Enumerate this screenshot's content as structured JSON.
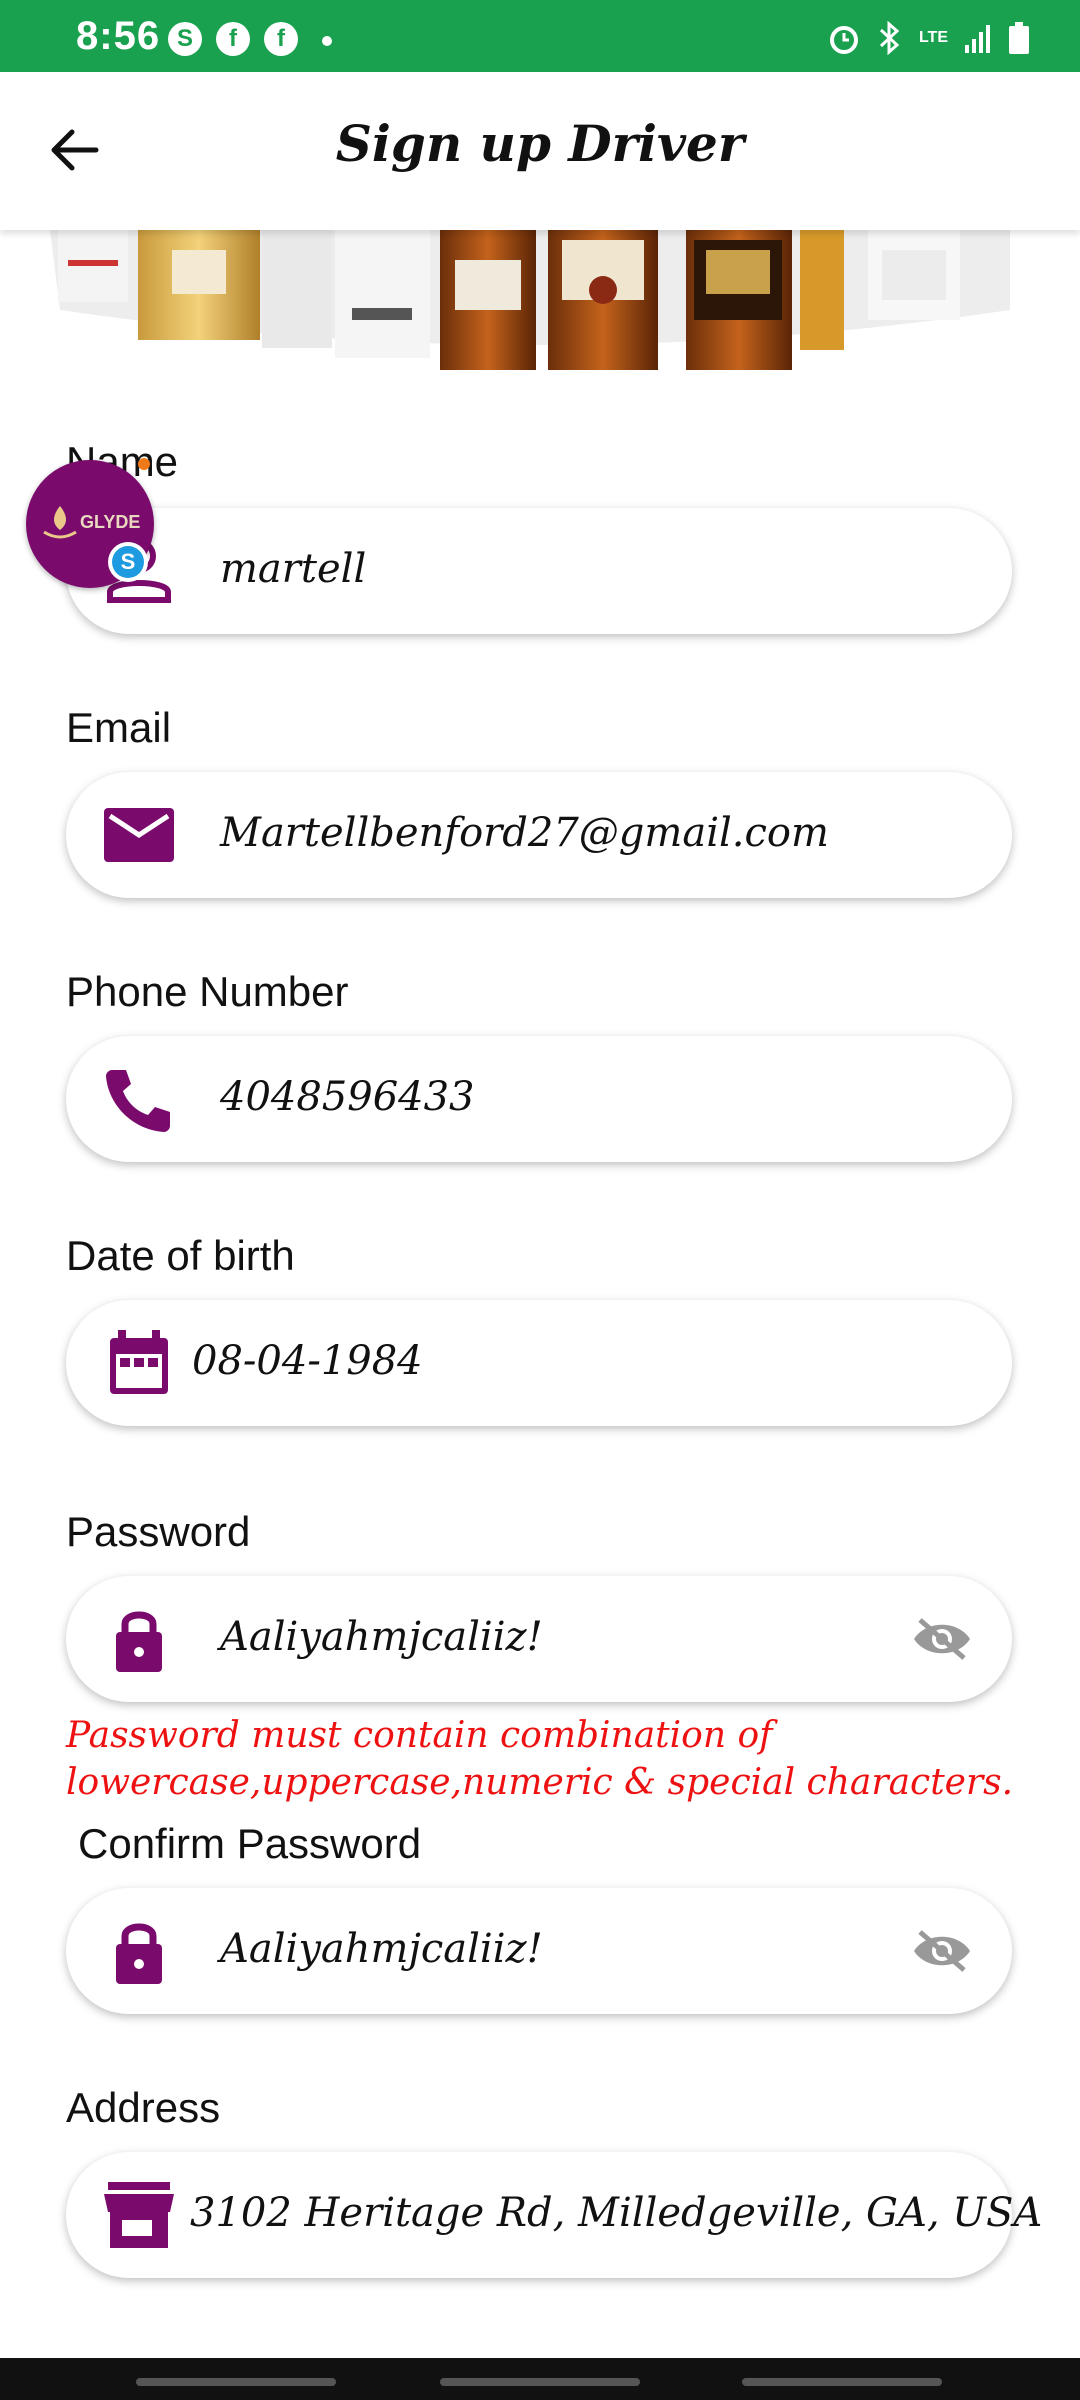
{
  "status_bar": {
    "time": "8:56",
    "network": "LTE"
  },
  "header": {
    "title": "Sign up  Driver"
  },
  "fab": {
    "logo_text": "GLYDE",
    "badge": "S"
  },
  "form": {
    "name": {
      "label": "Name",
      "value": "martell"
    },
    "email": {
      "label": "Email",
      "value": "Martellbenford27@gmail.com"
    },
    "phone": {
      "label": "Phone Number",
      "value": "4048596433"
    },
    "dob": {
      "label": "Date of birth",
      "value": "08-04-1984"
    },
    "password": {
      "label": "Password",
      "value": "Aaliyahmjcaliiz!"
    },
    "password_error": "Password must contain combination of lowercase,uppercase,numeric & special characters.",
    "confirm_password": {
      "label": "Confirm Password",
      "value": "Aaliyahmjcaliiz!"
    },
    "address": {
      "label": "Address",
      "value": "3102 Heritage Rd, Milledgeville, GA, USA"
    }
  },
  "colors": {
    "status_bar": "#1aa14f",
    "accent": "#7a0a6c",
    "error": "#e11111"
  }
}
